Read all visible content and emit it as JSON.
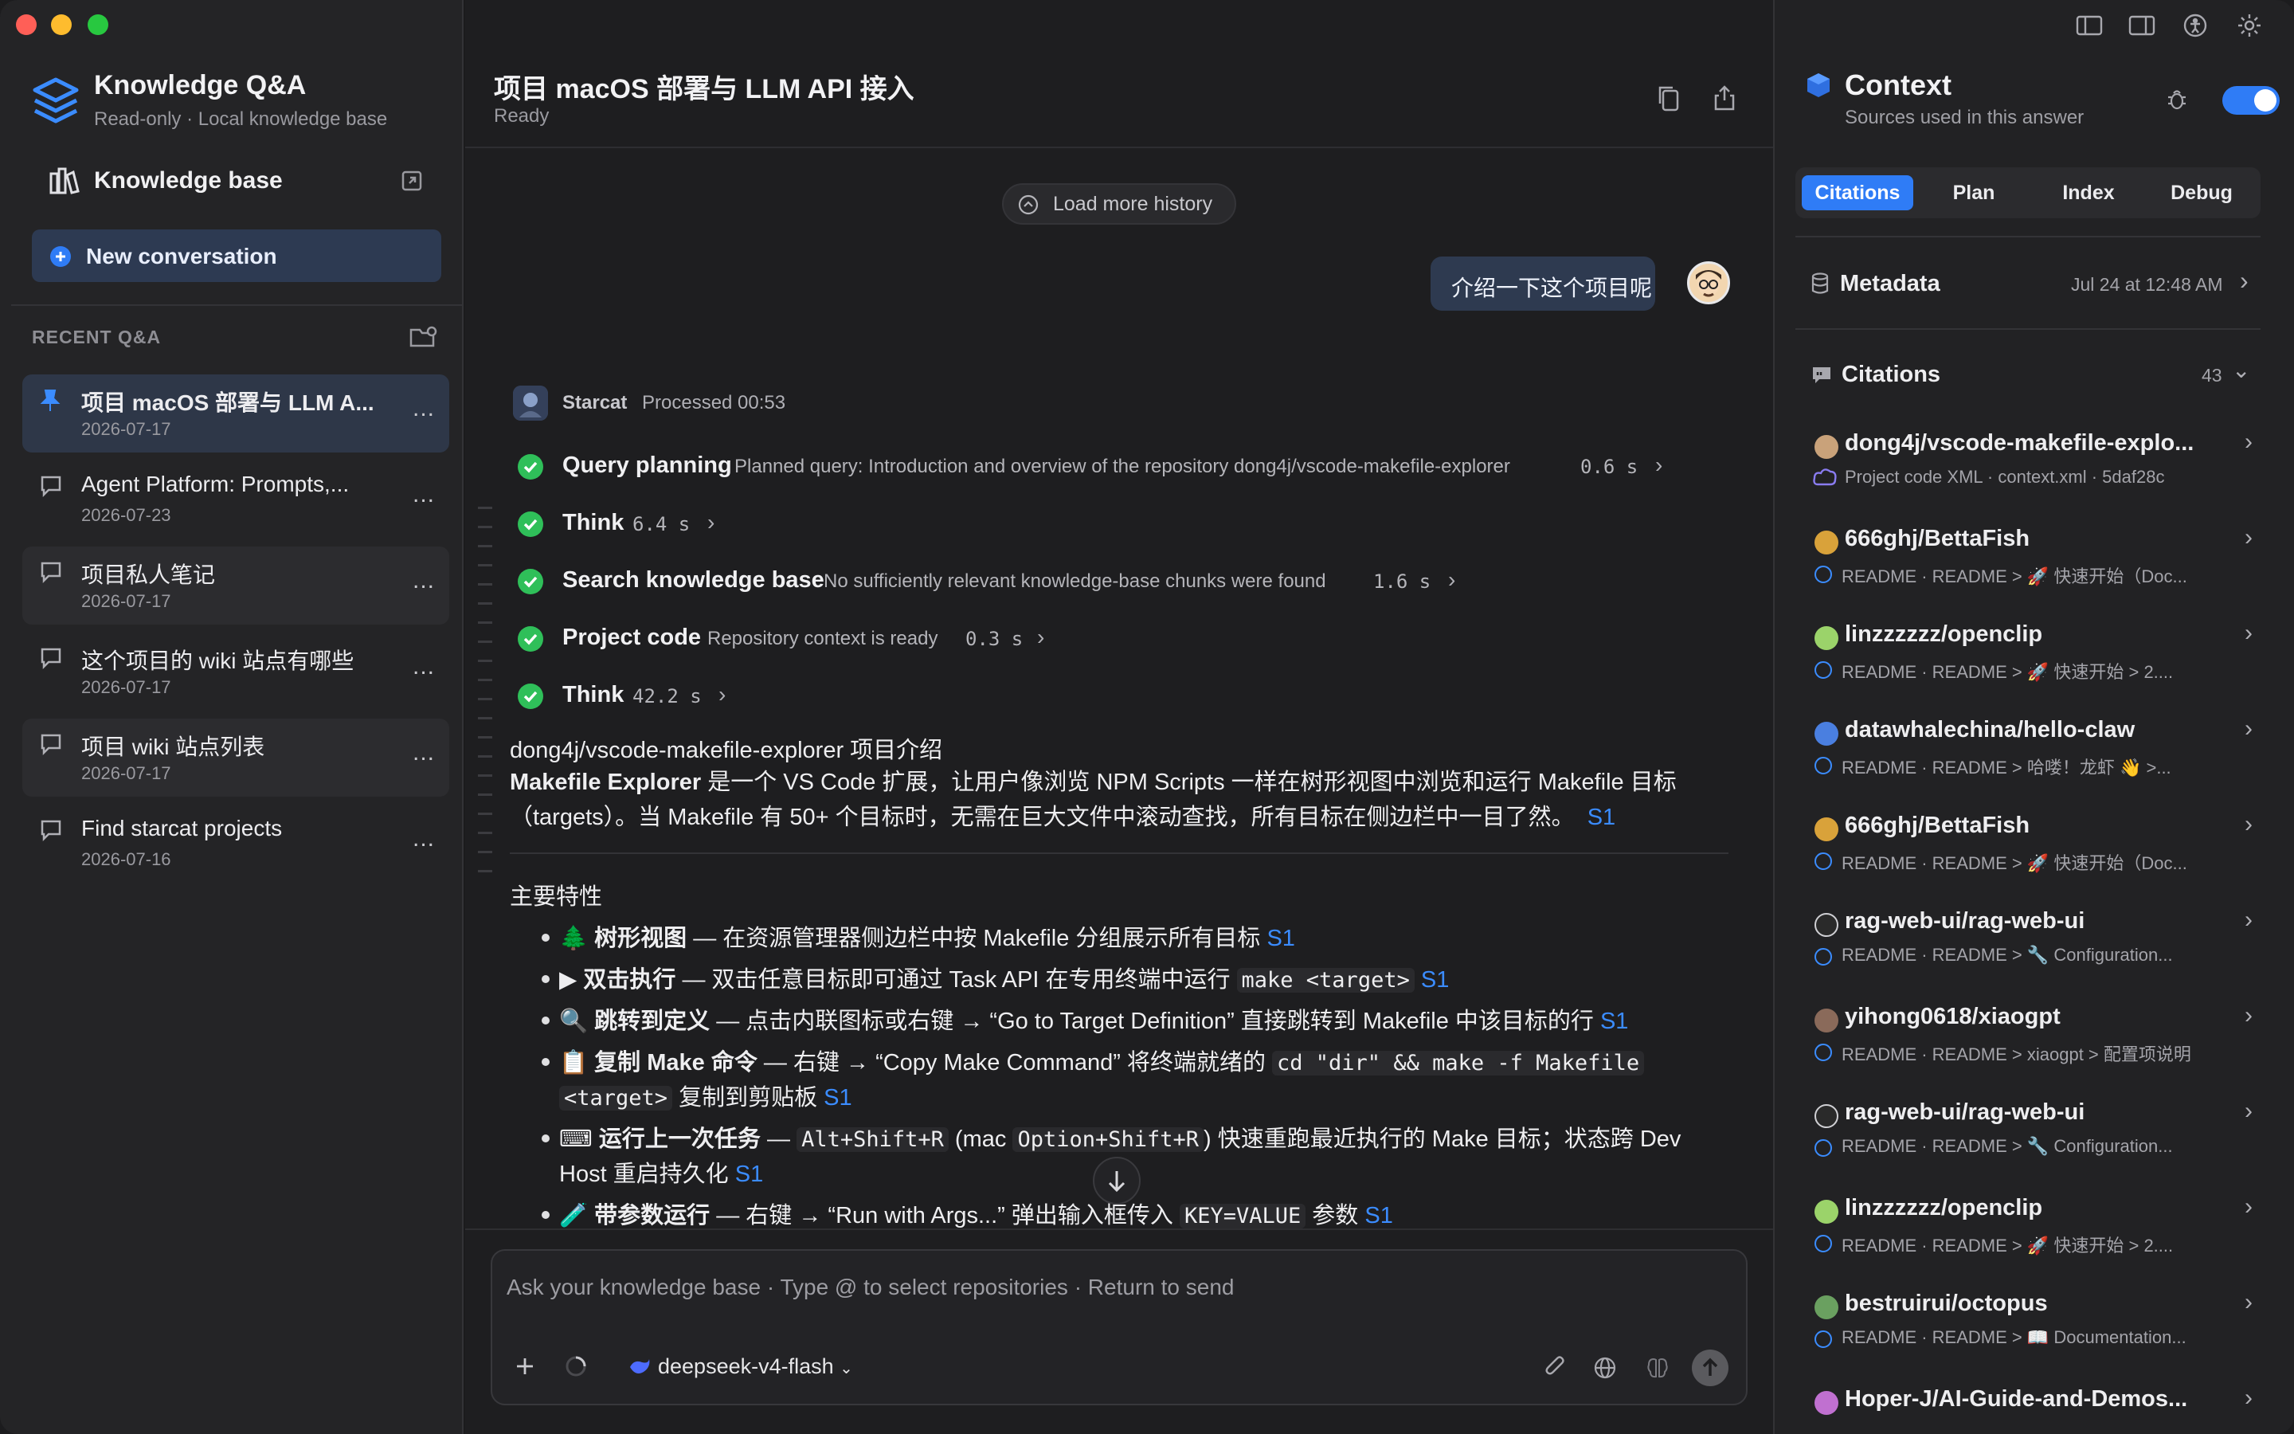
{
  "app": {
    "title": "Knowledge Q&A",
    "subtitle": "Read-only · Local knowledge base",
    "traffic_colors": [
      "#ff5f57",
      "#febc2e",
      "#28c840"
    ]
  },
  "sidebar": {
    "knowledge_base_label": "Knowledge base",
    "new_conversation_label": "New conversation",
    "recent_label": "RECENT Q&A",
    "conversations": [
      {
        "title": "项目 macOS 部署与 LLM A...",
        "date": "2026-07-17",
        "pinned": true
      },
      {
        "title": "Agent Platform: Prompts,...",
        "date": "2026-07-23"
      },
      {
        "title": "项目私人笔记",
        "date": "2026-07-17"
      },
      {
        "title": "这个项目的 wiki 站点有哪些",
        "date": "2026-07-17"
      },
      {
        "title": "项目 wiki 站点列表",
        "date": "2026-07-17"
      },
      {
        "title": "Find starcat projects",
        "date": "2026-07-16"
      }
    ],
    "more_label": "..."
  },
  "main": {
    "title": "项目 macOS 部署与 LLM API 接入",
    "status": "Ready",
    "load_more": "Load more history",
    "user_message": "介绍一下这个项目呢",
    "bot_name": "Starcat",
    "processed": "Processed 00:53",
    "steps": [
      {
        "title": "Query planning",
        "detail": "Planned query: Introduction and overview of the repository dong4j/vscode-makefile-explorer",
        "time": "0.6 s"
      },
      {
        "title": "Think",
        "detail": "",
        "time": "6.4 s"
      },
      {
        "title": "Search knowledge base",
        "detail": "No sufficiently relevant knowledge-base chunks were found",
        "time": "1.6 s"
      },
      {
        "title": "Project code",
        "detail": "Repository context is ready",
        "time": "0.3 s"
      },
      {
        "title": "Think",
        "detail": "",
        "time": "42.2 s"
      }
    ],
    "answer": {
      "heading": "dong4j/vscode-makefile-explorer 项目介绍",
      "intro_bold": "Makefile Explorer",
      "intro_line1": " 是一个 VS Code 扩展，让用户像浏览 NPM Scripts 一样在树形视图中浏览和运行 Makefile 目标",
      "intro_line2": "（targets）。当 Makefile 有 50+ 个目标时，无需在巨大文件中滚动查找，所有目标在侧边栏中一目了然。",
      "cite": "S1",
      "features_heading": "主要特性",
      "f1_emoji": "🌲",
      "f1_bold": "树形视图",
      "f1_text": " — 在资源管理器侧边栏中按 Makefile 分组展示所有目标",
      "f2_emoji": "▶",
      "f2_bold": "双击执行",
      "f2_text": " — 双击任意目标即可通过 Task API 在专用终端中运行 ",
      "f2_code": "make <target>",
      "f3_emoji": "🔍",
      "f3_bold": "跳转到定义",
      "f3_text": " — 点击内联图标或右键 → “Go to Target Definition” 直接跳转到 Makefile 中该目标的行",
      "f4_emoji": "📋",
      "f4_bold": "复制 Make 命令",
      "f4_text": " — 右键 → “Copy Make Command” 将终端就绪的 ",
      "f4_code1": "cd \"dir\" && make -f Makefile",
      "f4_code2": "<target>",
      "f4_text2": " 复制到剪贴板",
      "f5_emoji": "⌨",
      "f5_bold": "运行上一次任务",
      "f5_text_a": " — ",
      "f5_code1": "Alt+Shift+R",
      "f5_text_b": " (mac ",
      "f5_code2": "Option+Shift+R",
      "f5_text_c": ") 快速重跑最近执行的 Make 目标；状态跨 Dev",
      "f5_text_d": "Host 重启持久化",
      "f6_emoji": "🧪",
      "f6_bold": "带参数运行",
      "f6_text": " — 右键 → “Run with Args...” 弹出输入框传入 ",
      "f6_code": "KEY=VALUE",
      "f6_text2": " 参数"
    },
    "composer_placeholder": "Ask your knowledge base · Type @ to select repositories · Return to send",
    "model": "deepseek-v4-flash"
  },
  "context": {
    "title": "Context",
    "subtitle": "Sources used in this answer",
    "tabs": [
      "Citations",
      "Plan",
      "Index",
      "Debug"
    ],
    "metadata_label": "Metadata",
    "metadata_time": "Jul 24 at 12:48 AM",
    "citations_label": "Citations",
    "citations_count": "43",
    "items": [
      {
        "title": "dong4j/vscode-makefile-explo...",
        "sub": "Project code XML · context.xml · 5daf28c",
        "color": "#c9a27a"
      },
      {
        "title": "666ghj/BettaFish",
        "sub": "README · README > 🚀 快速开始（Doc...",
        "color": "#d9a23a"
      },
      {
        "title": "linzzzzzz/openclip",
        "sub": "README · README > 🚀 快速开始 > 2....",
        "color": "#9bd36a"
      },
      {
        "title": "datawhalechina/hello-claw",
        "sub": "README · README > 哈喽！龙虾 👋 >...",
        "color": "#4a7fe0"
      },
      {
        "title": "666ghj/BettaFish",
        "sub": "README · README > 🚀 快速开始（Doc...",
        "color": "#d9a23a"
      },
      {
        "title": "rag-web-ui/rag-web-ui",
        "sub": "README · README > 🔧 Configuration...",
        "color": "#2a2a2a"
      },
      {
        "title": "yihong0618/xiaogpt",
        "sub": "README · README > xiaogpt > 配置项说明",
        "color": "#8a6a5a"
      },
      {
        "title": "rag-web-ui/rag-web-ui",
        "sub": "README · README > 🔧 Configuration...",
        "color": "#2a2a2a"
      },
      {
        "title": "linzzzzzz/openclip",
        "sub": "README · README > 🚀 快速开始 > 2....",
        "color": "#9bd36a"
      },
      {
        "title": "bestruirui/octopus",
        "sub": "README · README > 📖 Documentation...",
        "color": "#6aa060"
      },
      {
        "title": "Hoper-J/AI-Guide-and-Demos...",
        "sub": "",
        "color": "#c070d0"
      }
    ]
  }
}
